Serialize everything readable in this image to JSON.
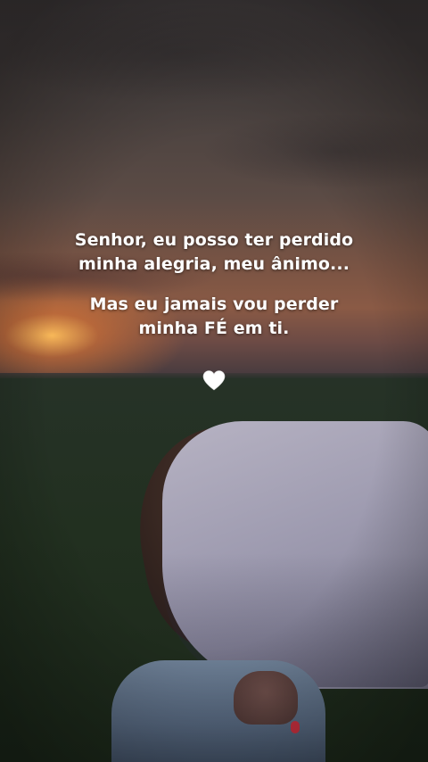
{
  "quote": {
    "line1": "Senhor, eu posso ter perdido",
    "line2": "minha alegria, meu ânimo...",
    "line3": "Mas eu jamais vou perder",
    "line4": "minha FÉ em ti."
  },
  "icons": {
    "heart": "white-heart-icon"
  },
  "colors": {
    "text": "#ffffff",
    "sunset": "#e08a4a",
    "grass": "#243022",
    "shirt": "#a8a5b9"
  }
}
